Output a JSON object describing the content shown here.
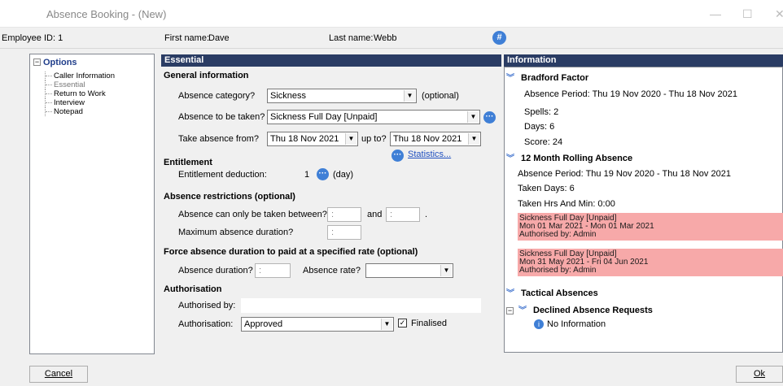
{
  "window": {
    "title": "Absence Booking - (New)"
  },
  "employee": {
    "id_label": "Employee ID: 1",
    "first_name_label": "First name:",
    "first_name": "Dave",
    "last_name_label": "Last name:",
    "last_name": "Webb"
  },
  "tree": {
    "root": "Options",
    "items": [
      "Caller Information",
      "Essential",
      "Return to Work",
      "Interview",
      "Notepad"
    ]
  },
  "essential": {
    "header": "Essential",
    "general_info": "General information",
    "absence_category_label": "Absence category?",
    "absence_category": "Sickness",
    "optional_text": "(optional)",
    "absence_to_be_taken_label": "Absence to be taken?",
    "absence_to_be_taken": "Sickness Full Day [Unpaid]",
    "take_from_label": "Take absence from?",
    "take_from": "Thu 18 Nov 2021",
    "up_to_label": "up to?",
    "up_to": "Thu 18 Nov 2021",
    "statistics_link": "Statistics...",
    "entitlement_header": "Entitlement",
    "entitlement_label": "Entitlement deduction:",
    "entitlement_value": "1",
    "entitlement_unit": "(day)",
    "restrictions_header": "Absence restrictions (optional)",
    "between_label": "Absence can only be taken between?",
    "between_from": ":",
    "and_label": "and",
    "between_to": ":",
    "between_end": ".",
    "max_duration_label": "Maximum absence duration?",
    "max_duration": ":",
    "force_header": "Force absence duration to paid at a specified rate (optional)",
    "duration_label": "Absence duration?",
    "duration": ":",
    "rate_label": "Absence rate?",
    "rate": "",
    "auth_header": "Authorisation",
    "authorised_by_label": "Authorised by:",
    "authorised_by": "",
    "authorisation_label": "Authorisation:",
    "authorisation": "Approved",
    "finalised_label": "Finalised",
    "finalised_check": "✓"
  },
  "information": {
    "header": "Information",
    "bradford": {
      "title": "Bradford Factor",
      "period": "Absence Period: Thu 19 Nov 2020 - Thu 18 Nov 2021",
      "spells": "Spells: 2",
      "days": "Days: 6",
      "score": "Score: 24"
    },
    "rolling": {
      "title": "12 Month Rolling Absence",
      "period": "Absence Period: Thu 19 Nov 2020 - Thu 18 Nov 2021",
      "taken_days": "Taken Days: 6",
      "taken_hrs": "Taken Hrs And Min: 0:00"
    },
    "records": [
      {
        "line1": "Sickness Full Day [Unpaid]",
        "line2": "Mon 01 Mar 2021 - Mon 01 Mar 2021",
        "line3": "Authorised by: Admin"
      },
      {
        "line1": "Sickness Full Day [Unpaid]",
        "line2": "Mon 31 May 2021 - Fri 04 Jun 2021",
        "line3": "Authorised by: Admin"
      }
    ],
    "tactical": "Tactical Absences",
    "declined": "Declined Absence Requests",
    "no_info": "No Information"
  },
  "buttons": {
    "cancel": "Cancel",
    "ok": "Ok"
  },
  "colors": {
    "header_bg": "#2a3c64",
    "record_bg": "#f7a9a9",
    "accent": "#3f7fd6"
  }
}
